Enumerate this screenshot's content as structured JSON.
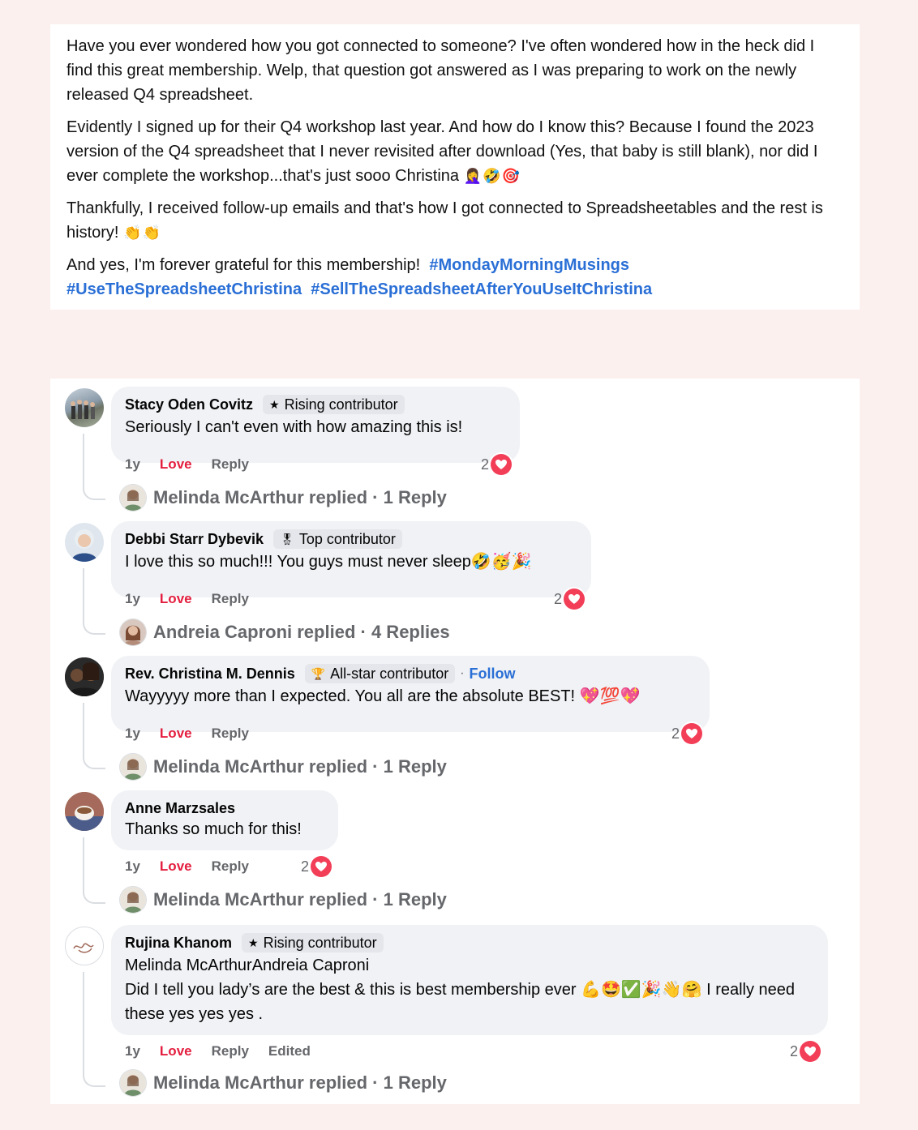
{
  "post": {
    "paragraphs": [
      "Have you ever wondered how you got connected to someone? I've often wondered how in the heck did I find this great membership. Welp, that question got answered as I was preparing to work on the newly released Q4 spreadsheet.",
      "Evidently I signed up for their Q4 workshop last year. And how do I know this? Because I found the 2023 version of the Q4 spreadsheet that I never revisited after download (Yes, that baby is still blank), nor did I ever complete the workshop...that's just sooo Christina",
      "Thankfully, I received follow-up emails and that's how I got connected to Spreadsheetables and the rest is history!",
      "And yes, I'm forever grateful for this membership!"
    ],
    "emoji_p2": "🤦‍♀️🤣🎯",
    "emoji_p3": "👏👏",
    "hashtags": [
      "#MondayMorningMusings",
      "#UseTheSpreadsheetChristina",
      "#SellTheSpreadsheetAfterYouUseItChristina"
    ]
  },
  "comments": [
    {
      "author": "Stacy Oden Covitz",
      "badge": "Rising contributor",
      "badge_icon": "star-icon",
      "text": "Seriously I can't even with how amazing this is!",
      "time": "1y",
      "love": "Love",
      "reply": "Reply",
      "reactions": "2",
      "replied_by": "Melinda McArthur replied",
      "reply_count": "· 1 Reply"
    },
    {
      "author": "Debbi Starr Dybevik",
      "badge": "Top contributor",
      "badge_icon": "medal-icon",
      "text": "I love this so much!!! You guys must never sleep🤣🥳🎉",
      "time": "1y",
      "love": "Love",
      "reply": "Reply",
      "reactions": "2",
      "replied_by": "Andreia Caproni replied",
      "reply_count": "· 4 Replies"
    },
    {
      "author": "Rev. Christina M. Dennis",
      "badge": "All-star contributor",
      "badge_icon": "trophy-icon",
      "follow": "Follow",
      "text": "Wayyyyy more than I expected. You all are the absolute BEST! 💖💯💖",
      "time": "1y",
      "love": "Love",
      "reply": "Reply",
      "reactions": "2",
      "replied_by": "Melinda McArthur replied",
      "reply_count": "· 1 Reply"
    },
    {
      "author": "Anne Marzsales",
      "text": "Thanks so much for this!",
      "time": "1y",
      "love": "Love",
      "reply": "Reply",
      "reactions": "2",
      "replied_by": "Melinda McArthur replied",
      "reply_count": "· 1 Reply"
    },
    {
      "author": "Rujina Khanom",
      "badge": "Rising contributor",
      "badge_icon": "star-icon",
      "mentions": "Melinda McArthurAndreia Caproni",
      "text": "Did I tell you lady’s are the best & this is best membership ever 💪🤩✅🎉👋🤗 I really need these yes yes yes .",
      "time": "1y",
      "love": "Love",
      "reply": "Reply",
      "edited": "Edited",
      "reactions": "2",
      "replied_by": "Melinda McArthur replied",
      "reply_count": "· 1 Reply"
    }
  ],
  "colors": {
    "page_bg": "#fcf0ee",
    "hashtag": "#2a6fd6",
    "love": "#e41e3f",
    "heart": "#f33e58",
    "bubble": "#f0f2f5"
  }
}
